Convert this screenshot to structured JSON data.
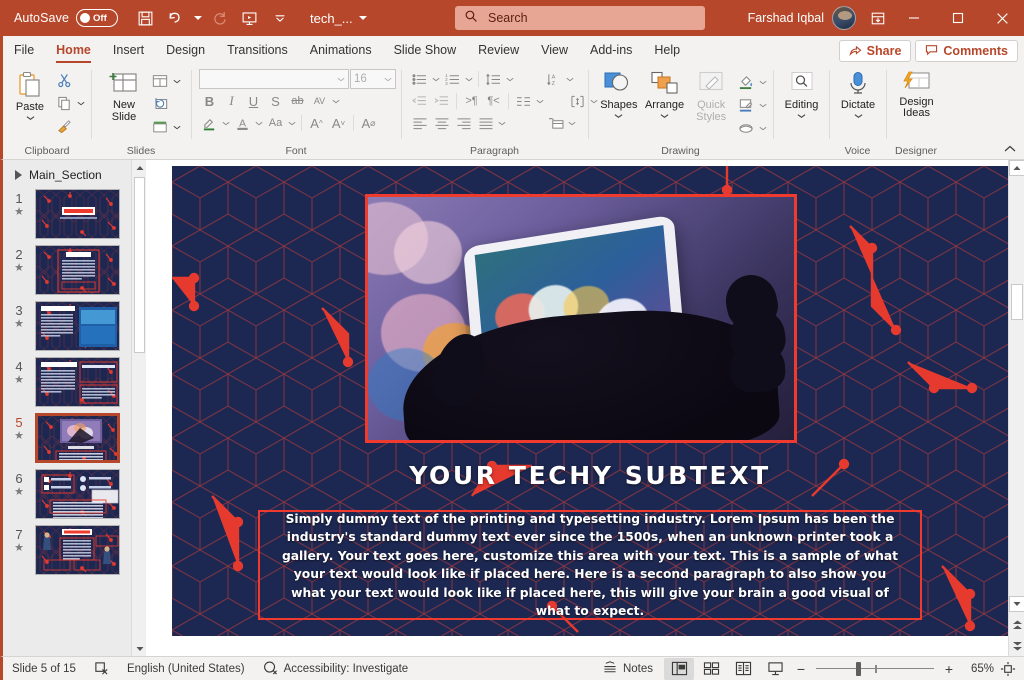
{
  "titlebar": {
    "autosave_label": "AutoSave",
    "autosave_state": "Off",
    "document_name": "tech_...",
    "user_name": "Farshad Iqbal",
    "qat": [
      {
        "name": "save-icon",
        "label": "Save"
      },
      {
        "name": "undo-icon",
        "label": "Undo"
      },
      {
        "name": "redo-icon",
        "label": "Redo"
      },
      {
        "name": "start-presentation-icon",
        "label": "Start From Beginning"
      },
      {
        "name": "customize-qat-icon",
        "label": "Customize Quick Access Toolbar"
      }
    ],
    "window_buttons": [
      "minimize",
      "maximize",
      "close"
    ],
    "ribbon_display_label": "Ribbon Display Options"
  },
  "search": {
    "placeholder": "Search",
    "icon": "search-icon"
  },
  "tabs": [
    {
      "label": "File",
      "active": false
    },
    {
      "label": "Home",
      "active": true
    },
    {
      "label": "Insert",
      "active": false
    },
    {
      "label": "Design",
      "active": false
    },
    {
      "label": "Transitions",
      "active": false
    },
    {
      "label": "Animations",
      "active": false
    },
    {
      "label": "Slide Show",
      "active": false
    },
    {
      "label": "Review",
      "active": false
    },
    {
      "label": "View",
      "active": false
    },
    {
      "label": "Add-ins",
      "active": false
    },
    {
      "label": "Help",
      "active": false
    }
  ],
  "tab_actions": {
    "share_label": "Share",
    "comments_label": "Comments"
  },
  "ribbon": {
    "groups": [
      {
        "name": "clipboard",
        "label": "Clipboard"
      },
      {
        "name": "slides",
        "label": "Slides"
      },
      {
        "name": "font",
        "label": "Font"
      },
      {
        "name": "paragraph",
        "label": "Paragraph"
      },
      {
        "name": "drawing",
        "label": "Drawing"
      },
      {
        "name": "voice",
        "label": "Voice"
      },
      {
        "name": "designer",
        "label": "Designer"
      }
    ],
    "clipboard": {
      "paste_label": "Paste",
      "cut_label": "Cut",
      "copy_label": "Copy",
      "format_painter_label": "Format Painter"
    },
    "slides": {
      "new_slide_label": "New Slide",
      "layout_label": "Layout",
      "reset_label": "Reset",
      "section_label": "Section"
    },
    "font": {
      "font_name": "",
      "font_size": "16",
      "bold": "B",
      "italic": "I",
      "underline": "U",
      "shadow": "S",
      "strikethrough": "ab",
      "char_spacing": "AV",
      "change_case": "Aa",
      "grow_font": "A",
      "shrink_font": "A",
      "clear_formatting": "A"
    },
    "drawing": {
      "shapes_label": "Shapes",
      "arrange_label": "Arrange",
      "quick_styles_label": "Quick Styles",
      "shape_fill_label": "Shape Fill",
      "shape_outline_label": "Shape Outline",
      "shape_effects_label": "Shape Effects"
    },
    "editing": {
      "label": "Editing"
    },
    "voice": {
      "dictate_label": "Dictate"
    },
    "designer": {
      "design_ideas_label": "Design Ideas"
    }
  },
  "thumbnails": {
    "section_name": "Main_Section",
    "slides": [
      {
        "number": "1",
        "selected": false
      },
      {
        "number": "2",
        "selected": false
      },
      {
        "number": "3",
        "selected": false
      },
      {
        "number": "4",
        "selected": false
      },
      {
        "number": "5",
        "selected": true
      },
      {
        "number": "6",
        "selected": false
      },
      {
        "number": "7",
        "selected": false
      }
    ]
  },
  "slide": {
    "title": "YOUR TECHY SUBTEXT",
    "body": "Simply dummy text of the printing and typesetting industry.  Lorem Ipsum has been the industry's standard dummy text ever since the 1500s, when an unknown printer took a gallery. Your text goes here, customize this area with your text. This is a sample of what your text would look like if placed here. Here is a second paragraph to also show you what your text would look like if placed here, this will give your brain a good visual of what to expect.",
    "image_alt": "hand-holding-smartphone-with-bokeh-lights",
    "colors": {
      "background": "#1d2852",
      "accent": "#ef3b2d",
      "text": "#ffffff"
    }
  },
  "statusbar": {
    "slide_indicator": "Slide 5 of 15",
    "accessibility_check_icon": "accessibility-checker-icon",
    "language": "English (United States)",
    "accessibility": "Accessibility: Investigate",
    "notes_label": "Notes",
    "views": [
      {
        "name": "normal-view",
        "active": true
      },
      {
        "name": "slide-sorter-view",
        "active": false
      },
      {
        "name": "reading-view",
        "active": false
      },
      {
        "name": "slide-show-view",
        "active": false
      }
    ],
    "zoom_out": "−",
    "zoom_in": "+",
    "zoom_level": "65%",
    "fit_to_window_label": "Fit slide to current window"
  }
}
